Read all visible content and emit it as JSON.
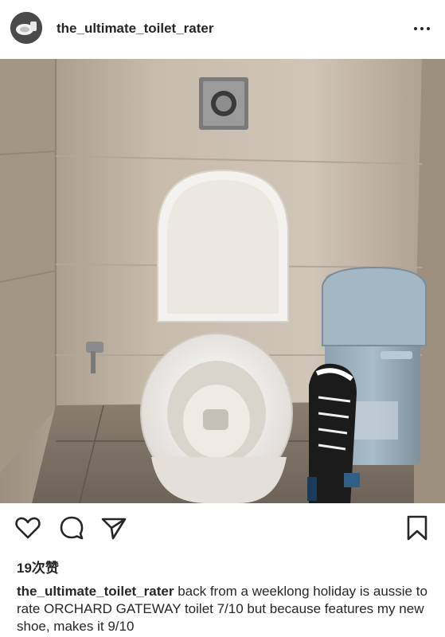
{
  "post": {
    "username": "the_ultimate_toilet_rater",
    "more_icon": "more-horizontal-icon",
    "likes": "19次赞",
    "caption_user": "the_ultimate_toilet_rater",
    "caption_text": "back from a weeklong holiday is aussie to rate ORCHARD GATEWAY toilet 7/10 but because features my new shoe, makes it 9/10"
  },
  "actions": {
    "like_icon": "heart-icon",
    "comment_icon": "comment-icon",
    "share_icon": "send-icon",
    "save_icon": "bookmark-icon"
  },
  "colors": {
    "text": "#262626",
    "background": "#ffffff"
  }
}
